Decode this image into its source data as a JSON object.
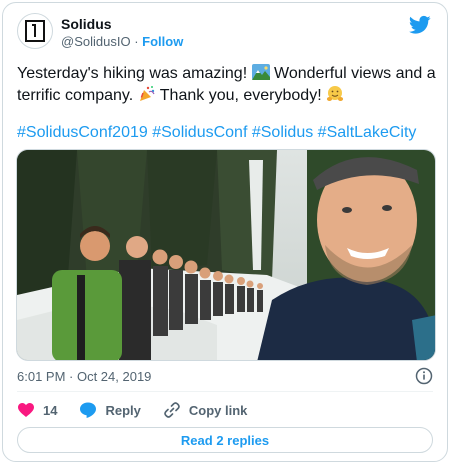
{
  "author": {
    "display_name": "Solidus",
    "handle": "@SolidusIO",
    "separator": "·",
    "follow_label": "Follow",
    "avatar_icon": "solidus-logo-icon"
  },
  "brand": {
    "icon": "twitter-bird-icon",
    "color": "#1d9bf0"
  },
  "tweet": {
    "text_part1": "Yesterday's hiking was amazing! ",
    "text_part2": " Wonderful views and a terrific company. ",
    "text_part3": " Thank you, everybody! ",
    "emojis": [
      "mountain-landscape-emoji",
      "party-popper-emoji",
      "hugging-face-emoji"
    ],
    "hashtags": [
      "#SolidusConf2019",
      "#SolidusConf",
      "#Solidus",
      "#SaltLakeCity"
    ],
    "media": "group-hiking-selfie-photo"
  },
  "meta": {
    "timestamp": "6:01 PM · Oct 24, 2019",
    "info_icon": "info-icon"
  },
  "actions": {
    "like_count": "14",
    "reply_label": "Reply",
    "copy_link_label": "Copy link"
  },
  "read_replies_label": "Read 2 replies",
  "colors": {
    "link": "#1d9bf0",
    "like": "#f91880",
    "muted": "#536471",
    "border": "#cfd9de"
  }
}
